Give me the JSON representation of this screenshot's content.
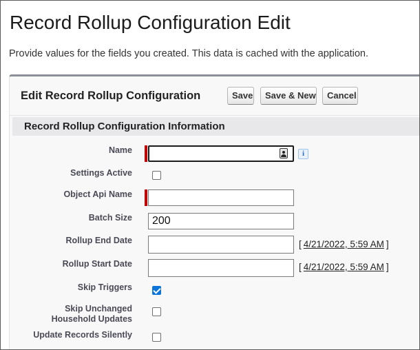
{
  "page": {
    "title": "Record Rollup Configuration Edit",
    "description": "Provide values for the fields you created. This data is cached with the application."
  },
  "panel": {
    "title": "Edit Record Rollup Configuration",
    "buttons": {
      "save": "Save",
      "save_new": "Save & New",
      "cancel": "Cancel"
    },
    "section_title": "Record Rollup Configuration Information"
  },
  "fields": {
    "name": {
      "label": "Name",
      "value": "",
      "required": true
    },
    "settings_active": {
      "label": "Settings Active",
      "checked": false
    },
    "object_api_name": {
      "label": "Object Api Name",
      "value": "",
      "required": true
    },
    "batch_size": {
      "label": "Batch Size",
      "value": "200"
    },
    "rollup_end_date": {
      "label": "Rollup End Date",
      "value": "",
      "date_link": "4/21/2022, 5:59 AM",
      "bracket_open": "[",
      "bracket_close": "]"
    },
    "rollup_start_date": {
      "label": "Rollup Start Date",
      "value": "",
      "date_link": "4/21/2022, 5:59 AM",
      "bracket_open": "[",
      "bracket_close": "]"
    },
    "skip_triggers": {
      "label": "Skip Triggers",
      "checked": true
    },
    "skip_unchanged_household_updates": {
      "label_line1": "Skip Unchanged",
      "label_line2": "Household Updates",
      "checked": false
    },
    "update_records_silently": {
      "label": "Update Records Silently",
      "checked": false
    }
  },
  "icons": {
    "info": "info-icon",
    "contact": "contact-card-icon"
  },
  "colors": {
    "required": "#c00000",
    "checkbox_checked": "#0b75d9",
    "section_header_bg": "#e8e8eb"
  }
}
